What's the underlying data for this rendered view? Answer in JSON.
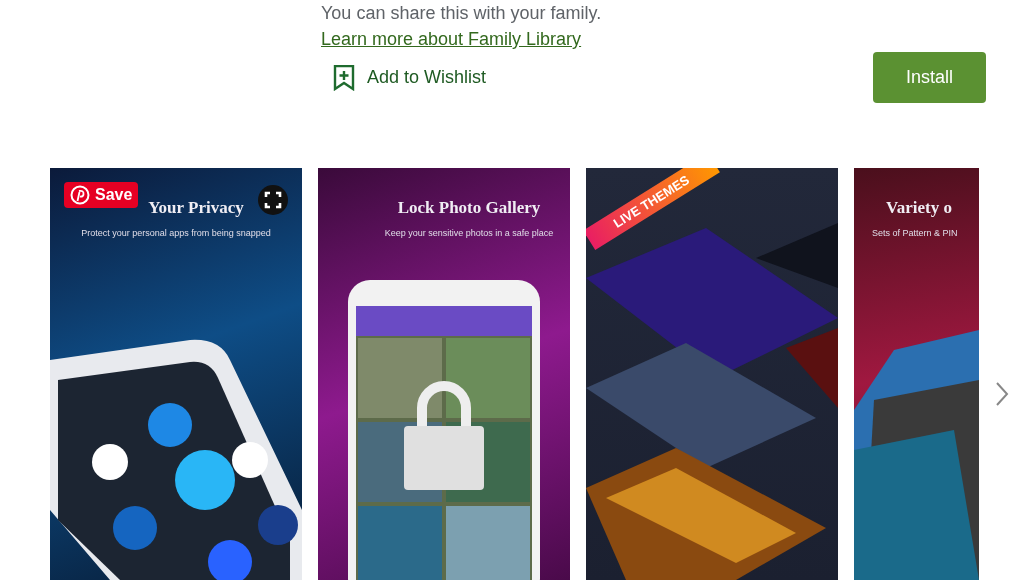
{
  "family_note": {
    "text": "You can share this with your family.",
    "link": "Learn more about Family Library"
  },
  "wishlist": {
    "label": "Add to Wishlist"
  },
  "install": {
    "label": "Install"
  },
  "screenshots": [
    {
      "kind": "privacy",
      "title": "Your Privacy",
      "subtitle": "Protect your personal apps from being snapped"
    },
    {
      "kind": "gallery",
      "title": "Lock Photo Gallery",
      "subtitle": "Keep your sensitive photos in a safe place"
    },
    {
      "kind": "themes",
      "ribbon": "LIVE THEMES"
    },
    {
      "kind": "variety",
      "title": "Variety o",
      "subtitle": "Sets of Pattern & PIN"
    }
  ],
  "pin_button": {
    "label": "Save"
  }
}
